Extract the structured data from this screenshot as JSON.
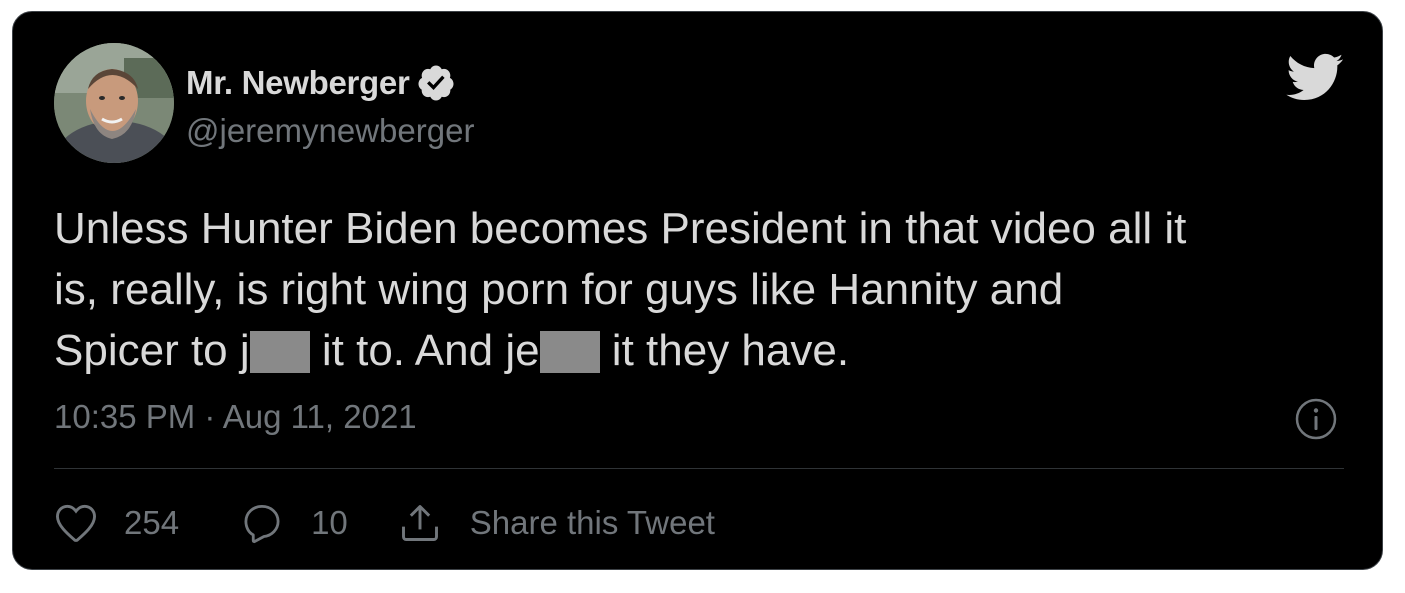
{
  "tweet": {
    "author": {
      "display_name": "Mr. Newberger",
      "handle": "@jeremynewberger",
      "verified": true
    },
    "text": {
      "line1": "Unless Hunter Biden becomes President in that video all it",
      "line2": "is, really, is right wing porn for guys like Hannity and",
      "line3_a": "Spicer to j",
      "line3_b": " it to. And je",
      "line3_c": " it they have."
    },
    "timestamp": "10:35 PM · Aug 11, 2021",
    "likes": "254",
    "replies": "10",
    "share_label": "Share this Tweet"
  },
  "icons": {
    "brand": "twitter-bird-icon",
    "verified": "verified-badge-icon",
    "info": "info-icon",
    "like": "heart-icon",
    "reply": "reply-icon",
    "share": "share-icon"
  },
  "colors": {
    "background": "#000000",
    "text": "#d9d9d9",
    "secondary_text": "#71767b",
    "divider": "#2f3336",
    "redaction": "#8a8a8a"
  }
}
